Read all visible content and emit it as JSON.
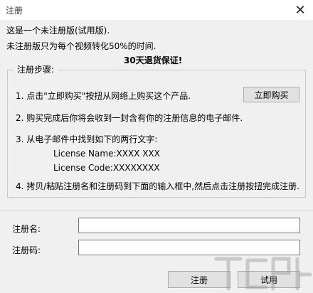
{
  "window": {
    "title": "注册",
    "close_glyph": "✕"
  },
  "intro": {
    "line1": "这是一个未注册版(试用版).",
    "line2": "未注册版只为每个视频转化50%的时间.",
    "guarantee": "30天退货保证!"
  },
  "steps": {
    "group_title": "注册步骤:",
    "step1": "1. 点击\"立即购买\"按扭从网络上购买这个产品.",
    "buy_button": "立即购买",
    "step2": "2. 购买完成后你将会收到一封含有你的注册信息的电子邮件.",
    "step3": "3. 从电子邮件中找到如下的两行文字:",
    "license_name": "License Name:XXXX XXX",
    "license_code": "License Code:XXXXXXXX",
    "step4": "4. 拷贝/粘贴注册名和注册码到下面的输入框中,然后点击注册按扭完成注册."
  },
  "form": {
    "name_label": "注册名:",
    "name_value": "",
    "code_label": "注册码:",
    "code_value": ""
  },
  "buttons": {
    "register": "注册",
    "trial": "试用"
  }
}
